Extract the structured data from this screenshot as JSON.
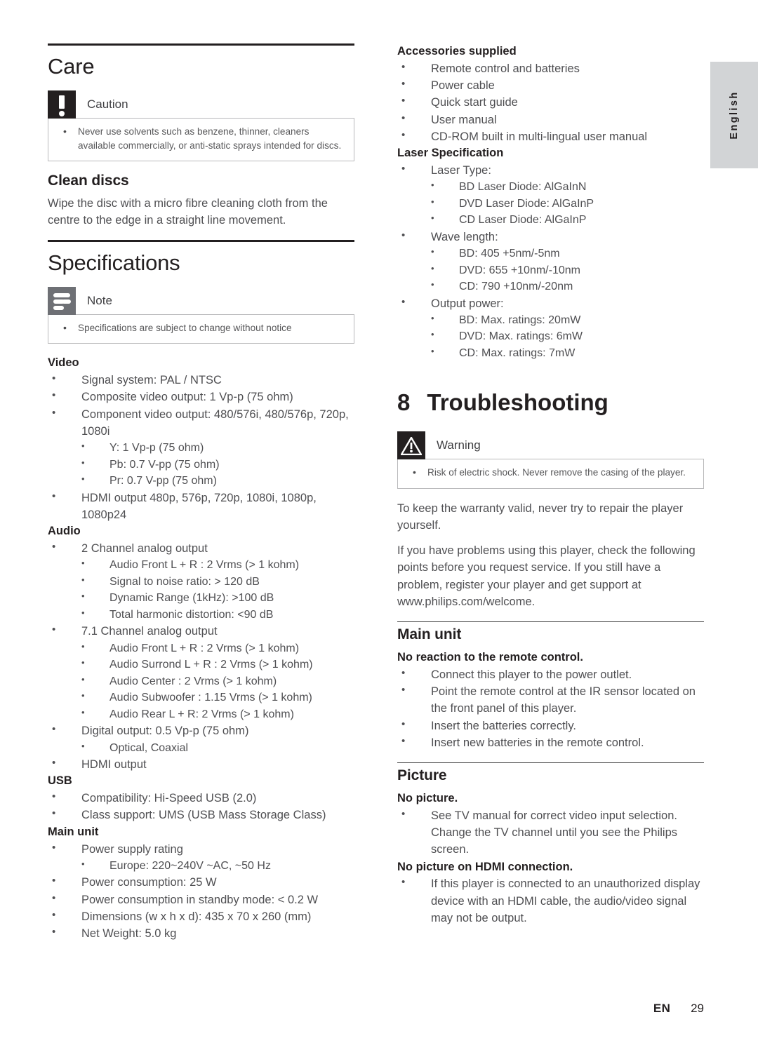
{
  "page": {
    "language_tab": "English",
    "footer": {
      "locale": "EN",
      "page_number": "29"
    }
  },
  "left_column": {
    "care": {
      "title": "Care",
      "caution": {
        "icon": "caution-exclamation-icon",
        "label": "Caution",
        "items": [
          "Never use solvents such as benzene, thinner, cleaners available commercially, or anti-static sprays intended for discs."
        ]
      },
      "clean_discs": {
        "heading": "Clean discs",
        "text": "Wipe the disc with a micro fibre cleaning cloth from the centre to the edge in a straight line movement."
      }
    },
    "specifications": {
      "title": "Specifications",
      "note": {
        "icon": "note-lines-icon",
        "label": "Note",
        "items": [
          "Specifications are subject to change without notice"
        ]
      },
      "groups": [
        {
          "name": "Video",
          "items": [
            {
              "text": "Signal system: PAL / NTSC"
            },
            {
              "text": "Composite video output: 1 Vp-p (75 ohm)"
            },
            {
              "text": "Component video output: 480/576i, 480/576p, 720p, 1080i",
              "sub": [
                "Y: 1 Vp-p (75 ohm)",
                "Pb: 0.7 V-pp (75 ohm)",
                "Pr: 0.7 V-pp (75 ohm)"
              ]
            },
            {
              "text": "HDMI output 480p, 576p, 720p, 1080i, 1080p, 1080p24"
            }
          ]
        },
        {
          "name": "Audio",
          "items": [
            {
              "text": "2 Channel analog output",
              "sub": [
                "Audio Front L + R : 2 Vrms (> 1 kohm)",
                "Signal to noise ratio: > 120 dB",
                "Dynamic Range (1kHz): >100 dB",
                "Total harmonic distortion: <90 dB"
              ]
            },
            {
              "text": "7.1 Channel analog output",
              "sub": [
                "Audio Front L + R : 2 Vrms (> 1 kohm)",
                "Audio Surrond L + R : 2 Vrms (> 1 kohm)",
                "Audio Center : 2 Vrms (> 1 kohm)",
                "Audio Subwoofer : 1.15 Vrms (> 1 kohm)",
                "Audio Rear L + R: 2 Vrms (> 1 kohm)"
              ]
            },
            {
              "text": "Digital output: 0.5 Vp-p (75 ohm)",
              "sub": [
                "Optical, Coaxial"
              ]
            },
            {
              "text": "HDMI output"
            }
          ]
        },
        {
          "name": "USB",
          "items": [
            {
              "text": "Compatibility: Hi-Speed USB (2.0)"
            },
            {
              "text": "Class support: UMS (USB Mass Storage Class)"
            }
          ]
        },
        {
          "name": "Main unit",
          "items": [
            {
              "text": "Power supply rating",
              "sub": [
                "Europe: 220~240V ~AC, ~50 Hz"
              ]
            },
            {
              "text": "Power consumption: 25 W"
            },
            {
              "text": "Power consumption in standby mode: < 0.2 W"
            },
            {
              "text": "Dimensions (w x h x d): 435 x 70 x 260 (mm)"
            },
            {
              "text": "Net Weight: 5.0 kg"
            }
          ]
        }
      ]
    }
  },
  "right_column": {
    "accessories": {
      "name": "Accessories supplied",
      "items": [
        {
          "text": "Remote control and batteries"
        },
        {
          "text": "Power cable"
        },
        {
          "text": "Quick start guide"
        },
        {
          "text": "User manual"
        },
        {
          "text": "CD-ROM built in multi-lingual user manual"
        }
      ]
    },
    "laser": {
      "name": "Laser Specification",
      "items": [
        {
          "text": "Laser Type:",
          "sub": [
            "BD Laser Diode: AlGaInN",
            "DVD Laser Diode: AlGaInP",
            "CD Laser Diode: AlGaInP"
          ]
        },
        {
          "text": "Wave length:",
          "sub": [
            "BD: 405 +5nm/-5nm",
            "DVD: 655 +10nm/-10nm",
            "CD: 790 +10nm/-20nm"
          ]
        },
        {
          "text": "Output power:",
          "sub": [
            "BD: Max. ratings: 20mW",
            "DVD: Max. ratings: 6mW",
            "CD: Max. ratings: 7mW"
          ]
        }
      ]
    },
    "troubleshooting": {
      "number": "8",
      "title": "Troubleshooting",
      "warning": {
        "icon": "warning-triangle-icon",
        "label": "Warning",
        "items": [
          "Risk of electric shock. Never remove the casing of the player."
        ]
      },
      "paragraphs": [
        "To keep the warranty valid, never try to repair the player yourself.",
        "If you have problems using this player, check the following points before you request service. If you still have a problem, register your player and get support at www.philips.com/welcome."
      ],
      "sections": [
        {
          "title": "Main unit",
          "problems": [
            {
              "symptom": "No reaction to the remote control.",
              "solutions": [
                "Connect this player to the power outlet.",
                "Point the remote control at the IR sensor located on the front panel of this player.",
                "Insert the batteries correctly.",
                "Insert new batteries in the remote control."
              ]
            }
          ]
        },
        {
          "title": "Picture",
          "problems": [
            {
              "symptom": "No picture.",
              "solutions": [
                "See TV manual for correct video input selection. Change the TV channel until you see the Philips screen."
              ]
            },
            {
              "symptom": "No picture on HDMI connection.",
              "solutions": [
                "If this player is connected to an unauthorized display device with an HDMI cable, the audio/video signal may not be output."
              ]
            }
          ]
        }
      ]
    }
  }
}
